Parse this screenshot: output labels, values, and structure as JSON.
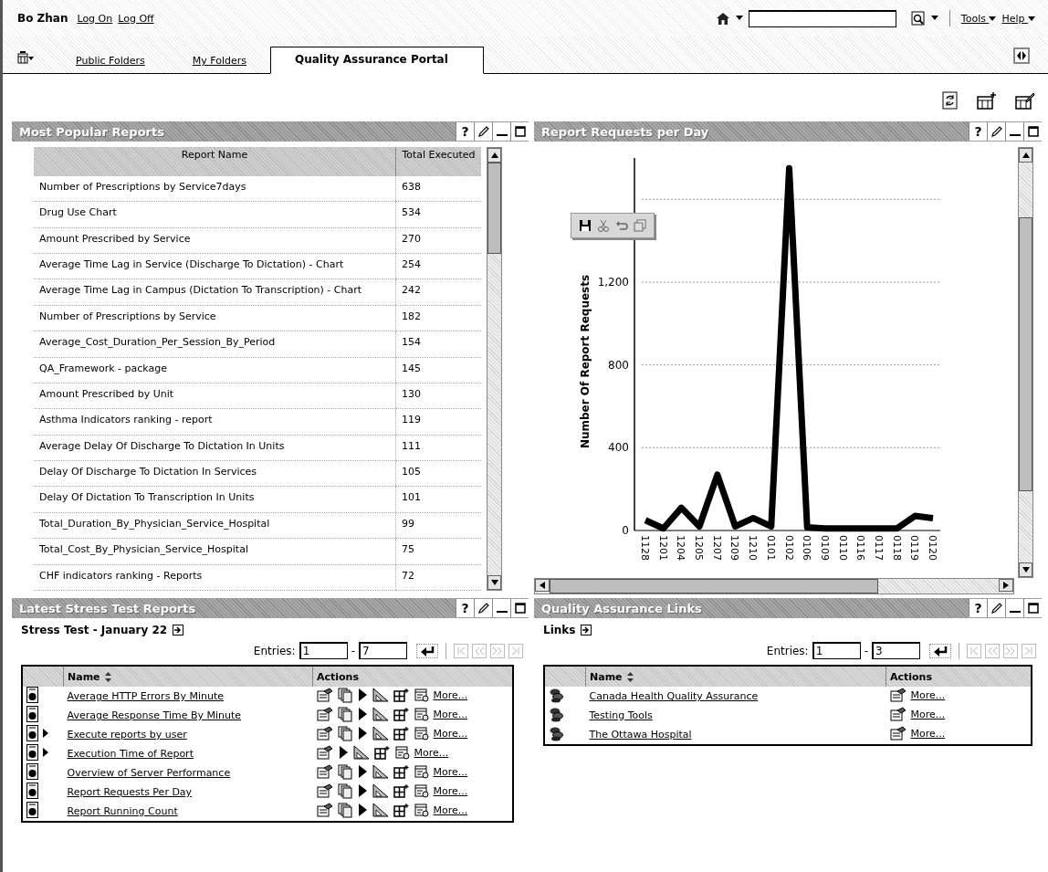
{
  "header": {
    "user": "Bo Zhan",
    "links": [
      "Log On",
      "Log Off"
    ],
    "menus": [
      "Tools",
      "Help"
    ]
  },
  "tabs": [
    {
      "label": "Public Folders",
      "selected": false
    },
    {
      "label": "My Folders",
      "selected": false
    },
    {
      "label": "Quality Assurance Portal",
      "selected": true
    }
  ],
  "most_popular": {
    "title": "Most Popular Reports",
    "help": "?",
    "columns": [
      "Report Name",
      "Total Executed"
    ],
    "rows": [
      {
        "name": "Number of Prescriptions by Service7days",
        "total": "638"
      },
      {
        "name": "Drug Use Chart",
        "total": "534"
      },
      {
        "name": "Amount Prescribed by Service",
        "total": "270"
      },
      {
        "name": "Average Time Lag in Service (Discharge To Dictation) - Chart",
        "total": "254"
      },
      {
        "name": "Average Time Lag in Campus (Dictation To Transcription) - Chart",
        "total": "242"
      },
      {
        "name": "Number of Prescriptions by Service",
        "total": "182"
      },
      {
        "name": "Average_Cost_Duration_Per_Session_By_Period",
        "total": "154"
      },
      {
        "name": "QA_Framework - package",
        "total": "145"
      },
      {
        "name": "Amount Prescribed by Unit",
        "total": "130"
      },
      {
        "name": "Asthma Indicators ranking - report",
        "total": "119"
      },
      {
        "name": "Average Delay Of Discharge To Dictation In Units",
        "total": "111"
      },
      {
        "name": "Delay Of Discharge To Dictation In Services",
        "total": "105"
      },
      {
        "name": "Delay Of Dictation To Transcription In Units",
        "total": "101"
      },
      {
        "name": "Total_Duration_By_Physician_Service_Hospital",
        "total": "99"
      },
      {
        "name": "Total_Cost_By_Physician_Service_Hospital",
        "total": "75"
      },
      {
        "name": "CHF indicators ranking - Reports",
        "total": "72"
      }
    ]
  },
  "report_requests": {
    "title": "Report Requests per Day",
    "help": "?",
    "chart_data": {
      "type": "line",
      "ylabel": "Number Of Report Requests",
      "categories": [
        "1128",
        "1201",
        "1204",
        "1205",
        "1207",
        "1209",
        "1210",
        "0101",
        "0102",
        "0106",
        "0109",
        "0110",
        "0116",
        "0117",
        "0118",
        "0119",
        "0120"
      ],
      "grid": true,
      "series": [
        {
          "color": "#000000",
          "values": [
            50,
            10,
            110,
            20,
            270,
            20,
            60,
            20,
            1750,
            15,
            10,
            10,
            10,
            10,
            10,
            70,
            60
          ]
        }
      ],
      "ylim": [
        0,
        1800
      ],
      "yticks": [
        {
          "value": 0,
          "label": "0"
        },
        {
          "value": 400,
          "label": "400"
        },
        {
          "value": 800,
          "label": "800"
        },
        {
          "value": 1200,
          "label": "1,200"
        }
      ]
    }
  },
  "stress_tests": {
    "title": "Latest Stress Test Reports",
    "help": "?",
    "folder": "Stress Test - January 22",
    "entries_label": "Entries:",
    "from": "1",
    "dash": "-",
    "to": "7",
    "nav_disabled": true,
    "columns": [
      "Name",
      "Actions"
    ],
    "rows": [
      {
        "name": "Average HTTP Errors By Minute",
        "running": false,
        "actions": [
          {
            "kind": "properties"
          },
          {
            "kind": "copy"
          },
          {
            "kind": "run"
          },
          {
            "kind": "analyze"
          },
          {
            "kind": "schedule"
          },
          {
            "kind": "versions"
          }
        ],
        "more": "More..."
      },
      {
        "name": "Average Response Time  By Minute",
        "running": false,
        "actions": [
          {
            "kind": "properties"
          },
          {
            "kind": "copy"
          },
          {
            "kind": "run"
          },
          {
            "kind": "analyze"
          },
          {
            "kind": "schedule"
          },
          {
            "kind": "versions"
          }
        ],
        "more": "More..."
      },
      {
        "name": "Execute reports by user",
        "running": true,
        "actions": [
          {
            "kind": "properties"
          },
          {
            "kind": "copy"
          },
          {
            "kind": "run"
          },
          {
            "kind": "analyze"
          },
          {
            "kind": "schedule"
          },
          {
            "kind": "versions"
          }
        ],
        "more": "More..."
      },
      {
        "name": "Execution Time of Report",
        "running": true,
        "actions": [
          {
            "kind": "properties"
          },
          {
            "kind": "run"
          },
          {
            "kind": "analyze"
          },
          {
            "kind": "schedule"
          },
          {
            "kind": "versions"
          }
        ],
        "more": "More..."
      },
      {
        "name": "Overview of Server Performance",
        "running": false,
        "actions": [
          {
            "kind": "properties"
          },
          {
            "kind": "copy"
          },
          {
            "kind": "run"
          },
          {
            "kind": "analyze"
          },
          {
            "kind": "schedule"
          },
          {
            "kind": "versions"
          }
        ],
        "more": "More..."
      },
      {
        "name": "Report Requests Per Day",
        "running": false,
        "actions": [
          {
            "kind": "properties"
          },
          {
            "kind": "copy"
          },
          {
            "kind": "run"
          },
          {
            "kind": "analyze"
          },
          {
            "kind": "schedule"
          },
          {
            "kind": "versions"
          }
        ],
        "more": "More..."
      },
      {
        "name": "Report Running Count",
        "running": false,
        "actions": [
          {
            "kind": "properties"
          },
          {
            "kind": "copy"
          },
          {
            "kind": "run"
          },
          {
            "kind": "analyze"
          },
          {
            "kind": "schedule"
          },
          {
            "kind": "versions"
          }
        ],
        "more": "More..."
      }
    ]
  },
  "qa_links": {
    "title": "Quality Assurance Links",
    "help": "?",
    "folder": "Links",
    "entries_label": "Entries:",
    "from": "1",
    "dash": "-",
    "to": "3",
    "nav_disabled": true,
    "columns": [
      "Name",
      "Actions"
    ],
    "rows": [
      {
        "name": "Canada Health Quality Assurance",
        "actions": [
          {
            "kind": "properties"
          }
        ],
        "more": "More..."
      },
      {
        "name": "Testing Tools",
        "actions": [
          {
            "kind": "properties"
          }
        ],
        "more": "More..."
      },
      {
        "name": "The Ottawa Hospital",
        "actions": [
          {
            "kind": "properties"
          }
        ],
        "more": "More..."
      }
    ]
  }
}
